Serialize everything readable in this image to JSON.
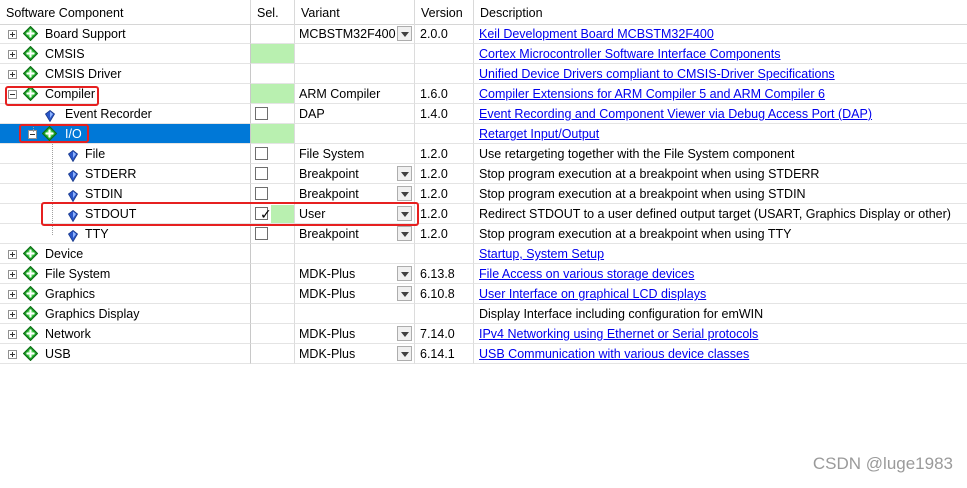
{
  "header": {
    "component": "Software Component",
    "sel": "Sel.",
    "variant": "Variant",
    "version": "Version",
    "description": "Description"
  },
  "rows": [
    {
      "name": "Board Support",
      "level": 0,
      "expander": "plus",
      "icon": "green-diamond-icon",
      "sel": "",
      "variant": "MCBSTM32F400",
      "dropdown": true,
      "version": "2.0.0",
      "desc": "Keil Development Board MCBSTM32F400",
      "link": true
    },
    {
      "name": "CMSIS",
      "level": 0,
      "expander": "plus",
      "icon": "green-diamond-icon",
      "sel": "green",
      "variant": "",
      "dropdown": false,
      "version": "",
      "desc": "Cortex Microcontroller Software Interface Components",
      "link": true
    },
    {
      "name": "CMSIS Driver",
      "level": 0,
      "expander": "plus",
      "icon": "green-diamond-icon",
      "sel": "",
      "variant": "",
      "dropdown": false,
      "version": "",
      "desc": "Unified Device Drivers compliant to CMSIS-Driver Specifications",
      "link": true
    },
    {
      "name": "Compiler",
      "level": 0,
      "expander": "minus",
      "icon": "green-diamond-icon",
      "sel": "green",
      "variant": "ARM Compiler",
      "dropdown": false,
      "version": "1.6.0",
      "desc": "Compiler Extensions for ARM Compiler 5 and ARM Compiler 6",
      "link": true
    },
    {
      "name": "Event Recorder",
      "level": 1,
      "expander": "",
      "icon": "blue-gem-icon",
      "sel": "checkbox",
      "variant": "DAP",
      "dropdown": false,
      "version": "1.4.0",
      "desc": "Event Recording and Component Viewer via Debug Access Port (DAP)",
      "link": true
    },
    {
      "name": "I/O",
      "level": 1,
      "expander": "minus",
      "icon": "green-diamond-icon",
      "sel": "green",
      "variant": "",
      "dropdown": false,
      "version": "",
      "desc": "Retarget Input/Output",
      "link": true,
      "selected": true
    },
    {
      "name": "File",
      "level": 2,
      "expander": "",
      "icon": "blue-gem-icon",
      "sel": "checkbox",
      "variant": "File System",
      "dropdown": false,
      "version": "1.2.0",
      "desc": "Use retargeting together with the File System component",
      "link": false
    },
    {
      "name": "STDERR",
      "level": 2,
      "expander": "",
      "icon": "blue-gem-icon",
      "sel": "checkbox",
      "variant": "Breakpoint",
      "dropdown": true,
      "version": "1.2.0",
      "desc": "Stop program execution at a breakpoint when using STDERR",
      "link": false
    },
    {
      "name": "STDIN",
      "level": 2,
      "expander": "",
      "icon": "blue-gem-icon",
      "sel": "checkbox",
      "variant": "Breakpoint",
      "dropdown": true,
      "version": "1.2.0",
      "desc": "Stop program execution at a breakpoint when using STDIN",
      "link": false
    },
    {
      "name": "STDOUT",
      "level": 2,
      "expander": "",
      "icon": "blue-gem-icon",
      "sel": "checked",
      "variant": "User",
      "dropdown": true,
      "version": "1.2.0",
      "desc": "Redirect STDOUT to a user defined output target (USART, Graphics Display or other)",
      "link": false
    },
    {
      "name": "TTY",
      "level": 2,
      "expander": "",
      "icon": "blue-gem-icon",
      "sel": "checkbox",
      "variant": "Breakpoint",
      "dropdown": true,
      "version": "1.2.0",
      "desc": "Stop program execution at a breakpoint when using TTY",
      "link": false
    },
    {
      "name": "Device",
      "level": 0,
      "expander": "plus",
      "icon": "green-diamond-icon",
      "sel": "",
      "variant": "",
      "dropdown": false,
      "version": "",
      "desc": "Startup, System Setup",
      "link": true
    },
    {
      "name": "File System",
      "level": 0,
      "expander": "plus",
      "icon": "green-diamond-icon",
      "sel": "",
      "variant": "MDK-Plus",
      "dropdown": true,
      "version": "6.13.8",
      "desc": "File Access on various storage devices",
      "link": true
    },
    {
      "name": "Graphics",
      "level": 0,
      "expander": "plus",
      "icon": "green-diamond-icon",
      "sel": "",
      "variant": "MDK-Plus",
      "dropdown": true,
      "version": "6.10.8",
      "desc": "User Interface on graphical LCD displays",
      "link": true
    },
    {
      "name": "Graphics Display",
      "level": 0,
      "expander": "plus",
      "icon": "green-diamond-icon",
      "sel": "",
      "variant": "",
      "dropdown": false,
      "version": "",
      "desc": "Display Interface including configuration for emWIN",
      "link": false
    },
    {
      "name": "Network",
      "level": 0,
      "expander": "plus",
      "icon": "green-diamond-icon",
      "sel": "",
      "variant": "MDK-Plus",
      "dropdown": true,
      "version": "7.14.0",
      "desc": "IPv4 Networking using Ethernet or Serial protocols",
      "link": true
    },
    {
      "name": "USB",
      "level": 0,
      "expander": "plus",
      "icon": "green-diamond-icon",
      "sel": "",
      "variant": "MDK-Plus",
      "dropdown": true,
      "version": "6.14.1",
      "desc": "USB Communication with various device classes",
      "link": true
    }
  ],
  "watermark": "CSDN @luge1983",
  "colors": {
    "selected_row": "#0078d7",
    "green_sel": "#b9f0b0",
    "link": "#0000ee",
    "highlight_box": "#e62020"
  }
}
